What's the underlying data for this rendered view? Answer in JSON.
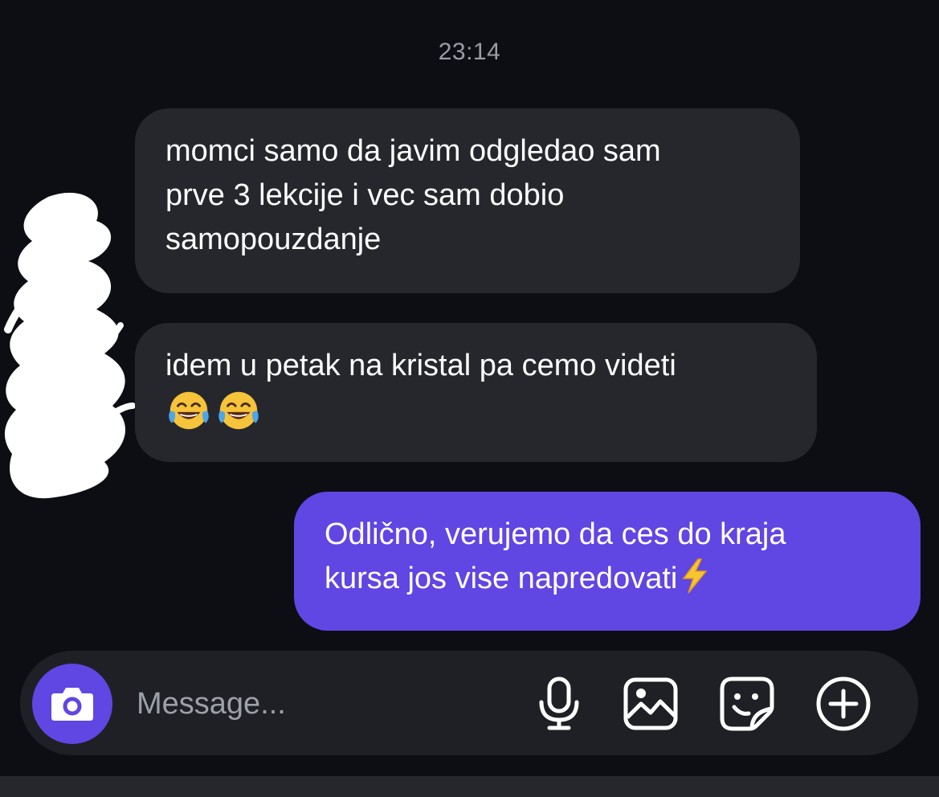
{
  "chat": {
    "timestamp": "23:14",
    "messages": [
      {
        "direction": "incoming",
        "lines": [
          "momci samo da javim odgledao sam",
          "prve 3 lekcije i vec sam dobio",
          "samopouzdanje"
        ]
      },
      {
        "direction": "incoming",
        "lines": [
          "idem u petak na kristal pa cemo videti"
        ],
        "emojis": [
          "tears-of-joy-emoji",
          "tears-of-joy-emoji"
        ]
      },
      {
        "direction": "outgoing",
        "lines": [
          "Odlično, verujemo da ces do kraja",
          "kursa jos vise napredovati"
        ],
        "trailing_emoji": "high-voltage-emoji"
      }
    ]
  },
  "composer": {
    "placeholder": "Message...",
    "value": "",
    "icons": [
      "camera-icon",
      "microphone-icon",
      "gallery-icon",
      "sticker-icon",
      "plus-icon"
    ]
  },
  "colors": {
    "background": "#0c0e14",
    "incoming_bubble": "#25272d",
    "outgoing_bubble": "#6046e2",
    "composer": "#1e2026",
    "accent": "#6046e2"
  }
}
